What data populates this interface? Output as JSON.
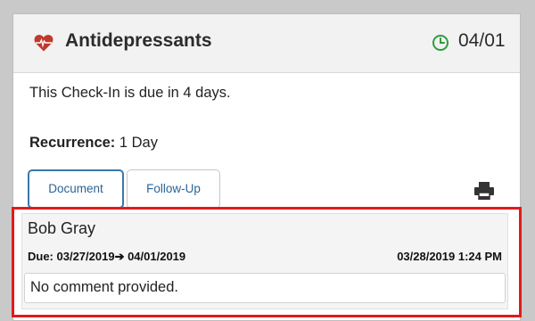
{
  "card": {
    "title": "Antidepressants",
    "due_date": "04/01",
    "due_text": "This Check-In is due in 4 days.",
    "recurrence_label": "Recurrence:",
    "recurrence_value": " 1 Day",
    "buttons": {
      "document": "Document",
      "follow_up": "Follow-Up"
    },
    "icons": {
      "heart": "heart-icon",
      "clock": "clock-icon",
      "print": "printer-icon"
    },
    "colors": {
      "heart": "#c0392b",
      "clock": "#2e9e3f",
      "link": "#2a6496",
      "highlight": "#e01b1b"
    }
  },
  "history": {
    "author": "Bob Gray",
    "due_range": "Due: 03/27/2019➔ 04/01/2019",
    "timestamp": "03/28/2019 1:24 PM",
    "comment": "No comment provided."
  }
}
